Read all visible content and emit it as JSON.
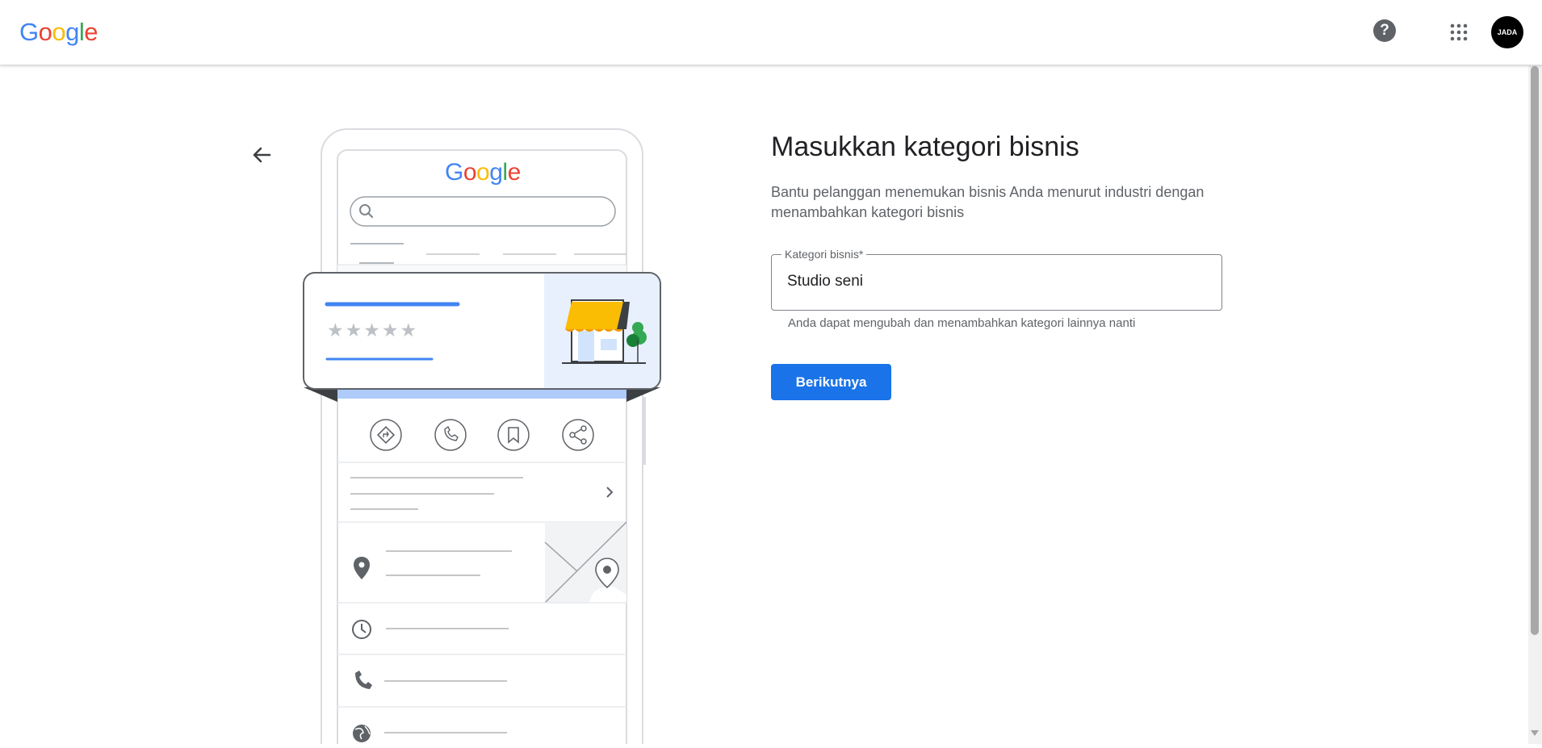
{
  "header": {
    "logo_letters": [
      {
        "ch": "G",
        "color": "#4285f4"
      },
      {
        "ch": "o",
        "color": "#ea4335"
      },
      {
        "ch": "o",
        "color": "#fbbc05"
      },
      {
        "ch": "g",
        "color": "#4285f4"
      },
      {
        "ch": "l",
        "color": "#34a853"
      },
      {
        "ch": "e",
        "color": "#ea4335"
      }
    ],
    "help_glyph": "?",
    "help_icon": "help-circle-icon",
    "apps_icon": "apps-grid-icon",
    "avatar_text": "JADA"
  },
  "illustration": {
    "logo_letters": [
      {
        "ch": "G",
        "color": "#4285f4"
      },
      {
        "ch": "o",
        "color": "#ea4335"
      },
      {
        "ch": "o",
        "color": "#fbbc05"
      },
      {
        "ch": "g",
        "color": "#4285f4"
      },
      {
        "ch": "l",
        "color": "#34a853"
      },
      {
        "ch": "e",
        "color": "#ea4335"
      }
    ],
    "stars": "★★★★★"
  },
  "main": {
    "title": "Masukkan kategori bisnis",
    "subtitle": "Bantu pelanggan menemukan bisnis Anda menurut industri dengan menambahkan kategori bisnis",
    "field": {
      "label": "Kategori bisnis*",
      "value": "Studio seni",
      "helper": "Anda dapat mengubah dan menambahkan kategori lainnya nanti"
    },
    "next_label": "Berikutnya"
  },
  "colors": {
    "primary": "#1a73e8",
    "awning": "#fbbc04",
    "panel": "#e8f0fe"
  }
}
